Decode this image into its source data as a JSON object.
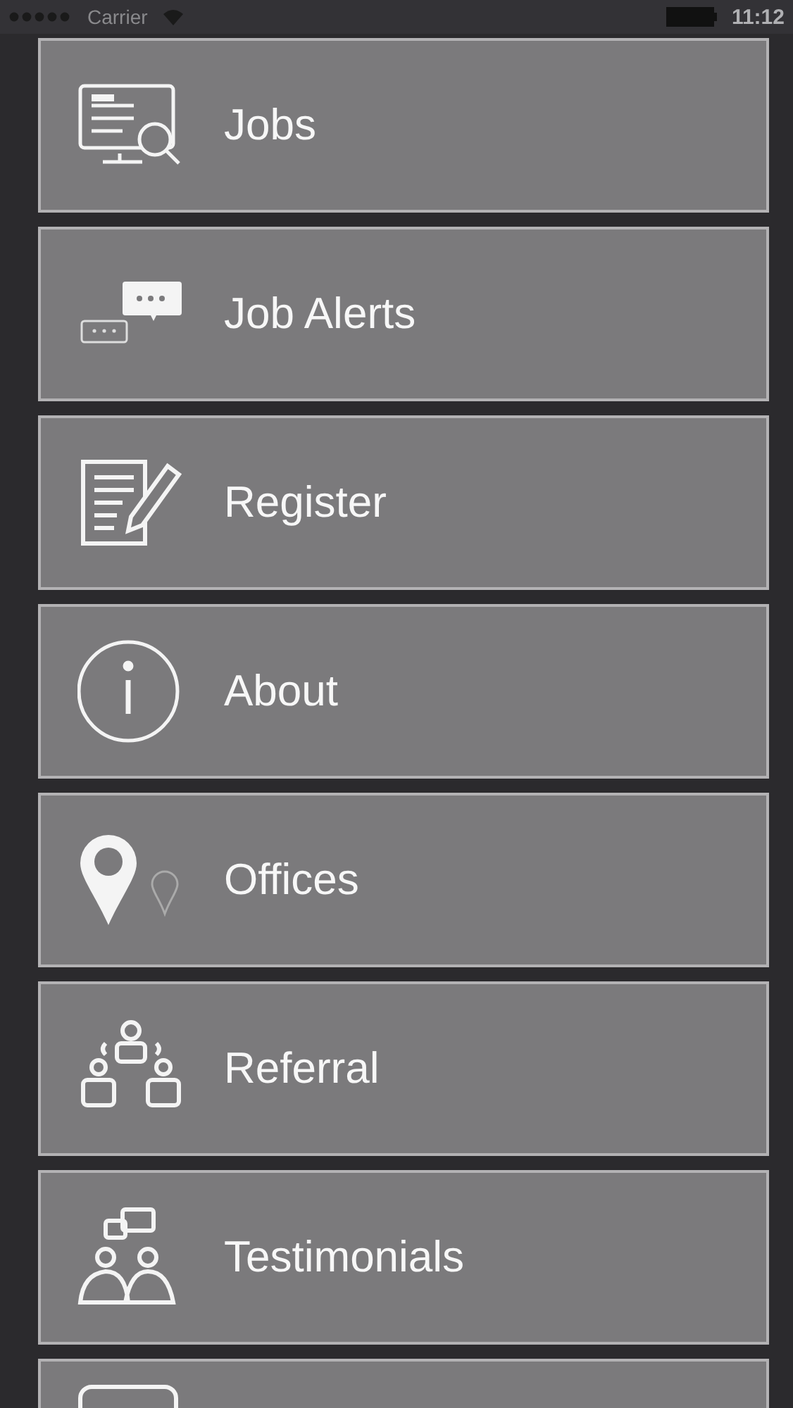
{
  "status_bar": {
    "carrier": "Carrier",
    "time": "11:12"
  },
  "menu": [
    {
      "label": "Jobs",
      "kind": "jobs"
    },
    {
      "label": "Job Alerts",
      "kind": "alerts"
    },
    {
      "label": "Register",
      "kind": "register"
    },
    {
      "label": "About",
      "kind": "about"
    },
    {
      "label": "Offices",
      "kind": "offices"
    },
    {
      "label": "Referral",
      "kind": "referral"
    },
    {
      "label": "Testimonials",
      "kind": "testimonials"
    },
    {
      "kind": "card"
    }
  ]
}
